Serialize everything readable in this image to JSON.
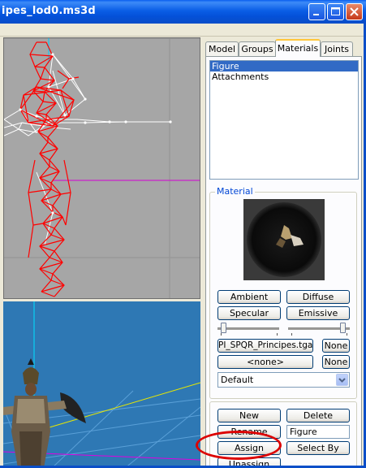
{
  "window": {
    "title": "ipes_lod0.ms3d"
  },
  "titlebar_buttons": [
    "minimize-icon",
    "maximize-icon",
    "close-icon"
  ],
  "tabs": [
    {
      "label": "Model",
      "active": false
    },
    {
      "label": "Groups",
      "active": false
    },
    {
      "label": "Materials",
      "active": true
    },
    {
      "label": "Joints",
      "active": false
    }
  ],
  "materials_list": [
    {
      "label": "Figure",
      "selected": true
    },
    {
      "label": "Attachments",
      "selected": false
    }
  ],
  "material": {
    "group_label": "Material",
    "ambient": "Ambient",
    "diffuse": "Diffuse",
    "specular": "Specular",
    "emissive": "Emissive",
    "texture": "PI_SPQR_Principes.tga",
    "texture_none": "None",
    "alpha": "<none>",
    "alpha_none": "None",
    "mode": "Default"
  },
  "actions": {
    "new": "New",
    "delete": "Delete",
    "rename": "Rename",
    "name_value": "Figure",
    "assign": "Assign",
    "select_by": "Select By",
    "cut_label": "Unassign"
  },
  "colors": {
    "titlebar": "#0a5ee6",
    "selection": "#316ac5",
    "wireframe": "#ff0000",
    "viewport_top": "#a6a6a6",
    "viewport_bottom": "#2e78b4",
    "annotation": "#dc0000"
  }
}
